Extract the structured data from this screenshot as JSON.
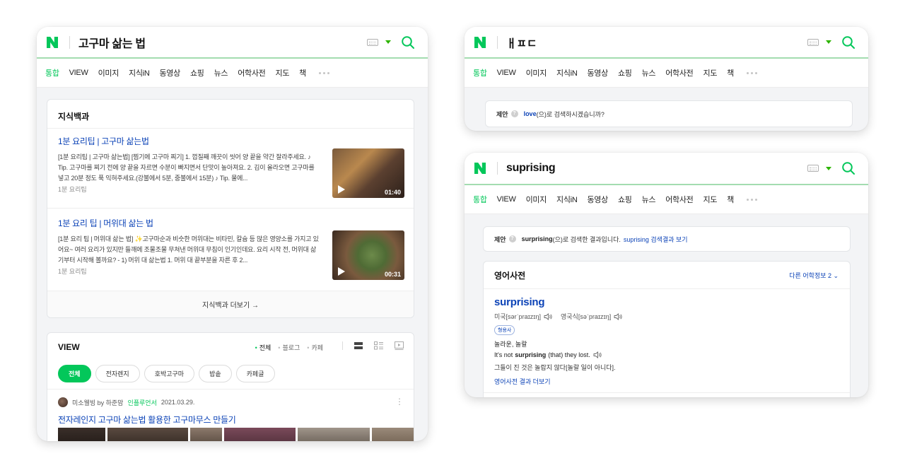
{
  "search_left": {
    "query": "고구마 삶는 법",
    "tabs": [
      "통합",
      "VIEW",
      "이미지",
      "지식iN",
      "동영상",
      "쇼핑",
      "뉴스",
      "어학사전",
      "지도",
      "책"
    ],
    "knowledge": {
      "title": "지식백과",
      "items": [
        {
          "title": "1분 요리팁 | 고구마 삶는법",
          "desc": "[1분 요리팁 | 고구마 삶는법] [찜기에 고구마 찌기] 1. 껍질째 깨끗이 씻어 양 끝을 약간 잘라주세요. ♪ Tip. 고구마를 찌기 전에 양 끝을 자르면 수분이 빠지면서 단맛이 높아져요. 2. 김이 올라오면 고구마를 넣고 20분 정도 푹 익혀주세요.(강불에서 5분, 중불에서 15분) ♪ Tip. 물에...",
          "source": "1분 요리팁",
          "duration": "01:40"
        },
        {
          "title": "1분 요리 팁 | 머위대 삶는 법",
          "desc": "[1분 요리 팁 | 머위대 삶는 법] ✨고구마순과 비슷한 머위대는 비타민, 칼슘 등 많은 영양소를 가지고 있어요~ 여러 요리가 있지만 들깨에 조물조물 무쳐낸 머위대 무침이 인기인데요. 요리 시작 전, 머위대 삶기부터 시작해 볼까요? - 1) 머위 대 삶는법 1. 머위 대 끝부분을 자른 후 2...",
          "source": "1분 요리팁",
          "duration": "00:31"
        }
      ],
      "more": "지식백과 더보기 →"
    },
    "view": {
      "title": "VIEW",
      "filters": [
        "전체",
        "블로그",
        "카페"
      ],
      "chips": [
        "전체",
        "전자렌지",
        "호박고구마",
        "밥솥",
        "카페글"
      ],
      "post_author": "미소웰빙 by 하준맘",
      "post_badge": "인플루언서",
      "post_date": "2021.03.29.",
      "post_title": "전자레인지 고구마 삶는법 활용한 고구마무스 만들기"
    }
  },
  "search_top_right": {
    "query": "ㅐㅍㄷ",
    "tabs": [
      "통합",
      "VIEW",
      "이미지",
      "지식iN",
      "동영상",
      "쇼핑",
      "뉴스",
      "어학사전",
      "지도",
      "책"
    ],
    "suggest_label": "제안",
    "suggest_word": "love",
    "suggest_text": "(으)로 검색하시겠습니까?"
  },
  "search_bottom_right": {
    "query": "suprising",
    "tabs": [
      "통합",
      "VIEW",
      "이미지",
      "지식iN",
      "동영상",
      "쇼핑",
      "뉴스",
      "어학사전",
      "지도",
      "책"
    ],
    "suggest_label": "제안",
    "suggest_word": "surprising",
    "suggest_text": "(으)로 검색한 결과입니다.",
    "suggest_link": "suprising 검색결과 보기",
    "dict": {
      "title": "영어사전",
      "other": "다른 어학정보 2 ⌄",
      "entry": "surprising",
      "us_pron": "미국[sərˈpraɪzɪŋ]",
      "uk_pron": "영국식[səˈpraɪzɪŋ]",
      "pos": "형용사",
      "meaning": "놀라운, 놀랄",
      "ex_pre": "It's not",
      "ex_bold": "surprising",
      "ex_post": "(that) they lost.",
      "translation": "그들이 진 것은 놀랍지 않다[놀랄 일이 아니다].",
      "more": "영어사전 결과 더보기"
    }
  },
  "colors": {
    "naver_green": "#03c75a",
    "link_blue": "#0c43b7"
  }
}
